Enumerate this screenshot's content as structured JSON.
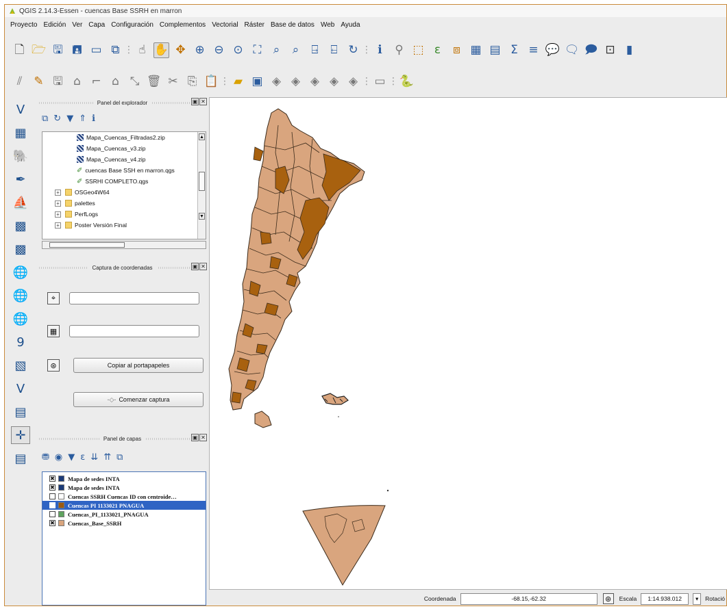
{
  "window": {
    "title": "QGIS 2.14.3-Essen - cuencas Base SSRH en marron"
  },
  "menu": [
    "Proyecto",
    "Edición",
    "Ver",
    "Capa",
    "Configuración",
    "Complementos",
    "Vectorial",
    "Ráster",
    "Base de datos",
    "Web",
    "Ayuda"
  ],
  "browser_panel": {
    "title": "Panel del explorador",
    "items": [
      {
        "label": "Mapa_Cuencas_Filtradas2.zip",
        "type": "zip"
      },
      {
        "label": "Mapa_Cuencas_v3.zip",
        "type": "zip"
      },
      {
        "label": "Mapa_Cuencas_v4.zip",
        "type": "zip"
      },
      {
        "label": "cuencas Base SSH en marron.qgs",
        "type": "qgs"
      },
      {
        "label": "SSRHI COMPLETO.qgs",
        "type": "qgs"
      },
      {
        "label": "OSGeo4W64",
        "type": "folder"
      },
      {
        "label": "palettes",
        "type": "folder"
      },
      {
        "label": "PerfLogs",
        "type": "folder"
      },
      {
        "label": "Poster Versión Final",
        "type": "folder"
      }
    ]
  },
  "coord_panel": {
    "title": "Captura de coordenadas",
    "copy_label": "Copiar al portapapeles",
    "start_label": "Comenzar captura",
    "start_prefix": "-◇-"
  },
  "layers_panel": {
    "title": "Panel de capas",
    "layers": [
      {
        "label": "Mapa de sedes INTA",
        "checked": "✖",
        "swatch": "#1b3a78",
        "selected": false
      },
      {
        "label": "Mapa de sedes INTA",
        "checked": "✖",
        "swatch": "#1b3a78",
        "selected": false
      },
      {
        "label": "Cuencas SSRH Cuencas ID con centroide…",
        "checked": "",
        "swatch": "#ffffff",
        "selected": false
      },
      {
        "label": "Cuencas PI 1133021 PNAGUA",
        "checked": "✖",
        "swatch": "#9c5a10",
        "selected": true
      },
      {
        "label": "Cuencas_PI_1133021_PNAGUA",
        "checked": "",
        "swatch": "#5fa35f",
        "selected": false
      },
      {
        "label": "Cuencas_Base_SSRH",
        "checked": "✖",
        "swatch": "#d9a57e",
        "selected": false
      }
    ]
  },
  "map": {
    "background": "#ffffff",
    "fill_light": "#d9a57e",
    "fill_dark": "#a8610f",
    "stroke": "#3a2a1a"
  },
  "statusbar": {
    "coord_label": "Coordenada",
    "coord_value": "-68.15,-62.32",
    "scale_label": "Escala",
    "scale_value": "1:14.938.012",
    "rotation_label": "Rotació"
  }
}
